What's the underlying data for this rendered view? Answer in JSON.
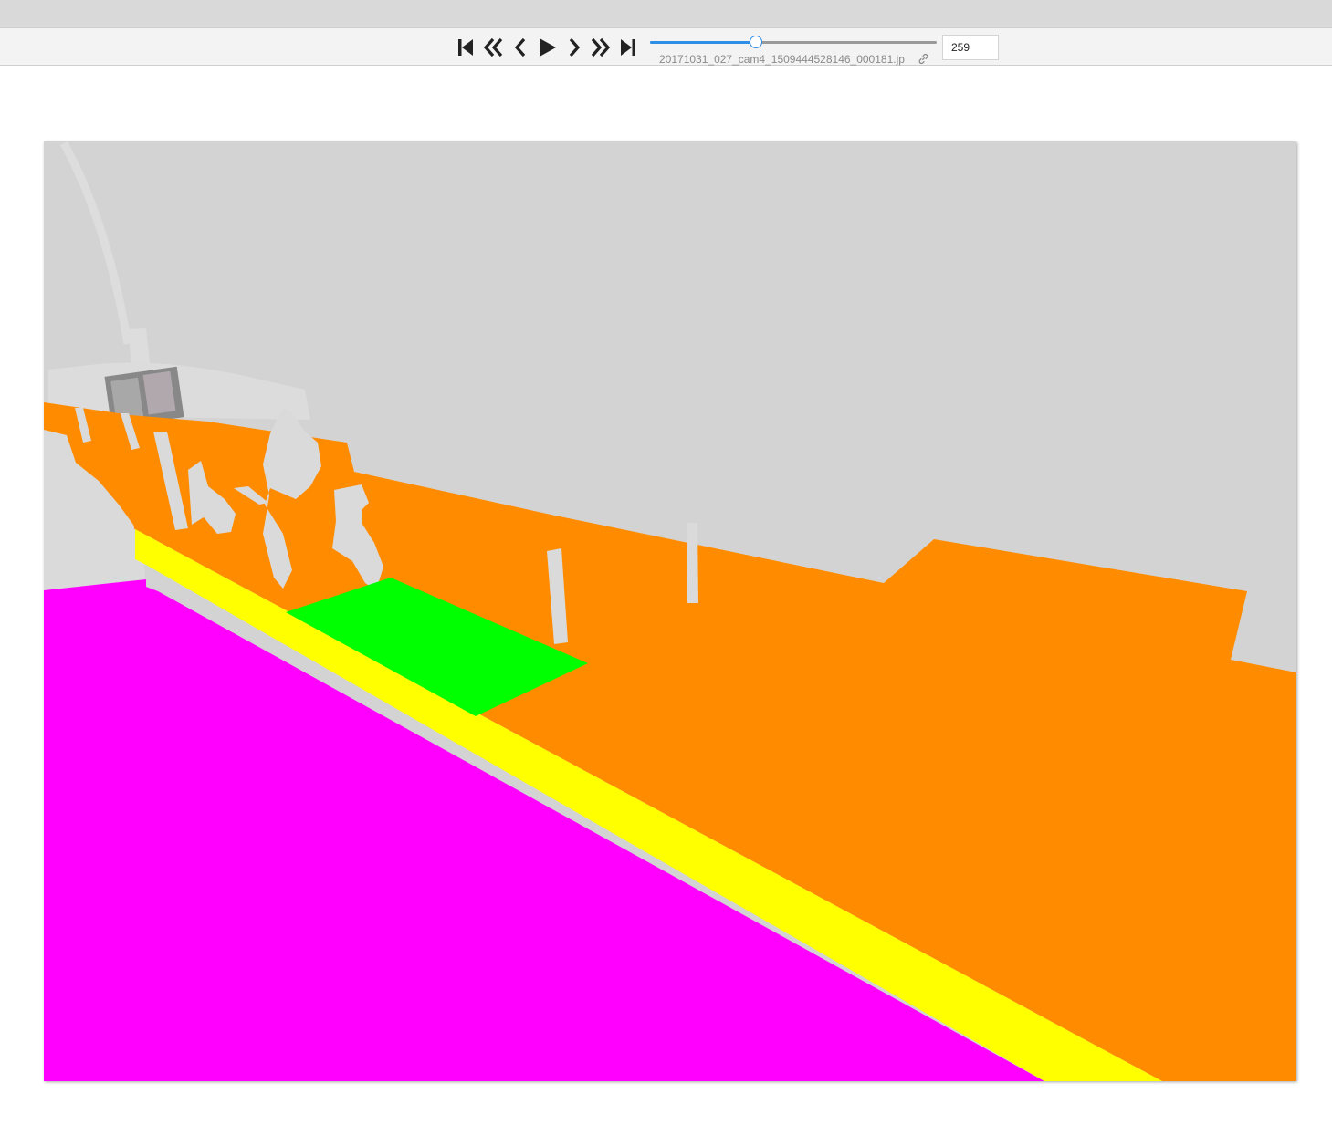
{
  "player": {
    "controls": [
      {
        "name": "first-frame-button",
        "icon": "skip-to-start-icon"
      },
      {
        "name": "jump-back-button",
        "icon": "double-chevron-left-icon"
      },
      {
        "name": "prev-frame-button",
        "icon": "chevron-left-icon"
      },
      {
        "name": "play-button",
        "icon": "play-icon"
      },
      {
        "name": "next-frame-button",
        "icon": "chevron-right-icon"
      },
      {
        "name": "jump-forward-button",
        "icon": "double-chevron-right-icon"
      },
      {
        "name": "last-frame-button",
        "icon": "skip-to-end-icon"
      }
    ],
    "slider_progress": 0.37,
    "filename": "20171031_027_cam4_1509444528146_000181.jp",
    "frame_value": "259",
    "link_icon": "link-icon",
    "accent_color": "#2f8ee6"
  },
  "scene": {
    "colors": {
      "background": "#d3d3d3",
      "road": "#ff8c00",
      "sidewalk": "#ff00ff",
      "curb": "#ffff00",
      "marking": "#00ff00",
      "objects": "#dadada"
    }
  }
}
